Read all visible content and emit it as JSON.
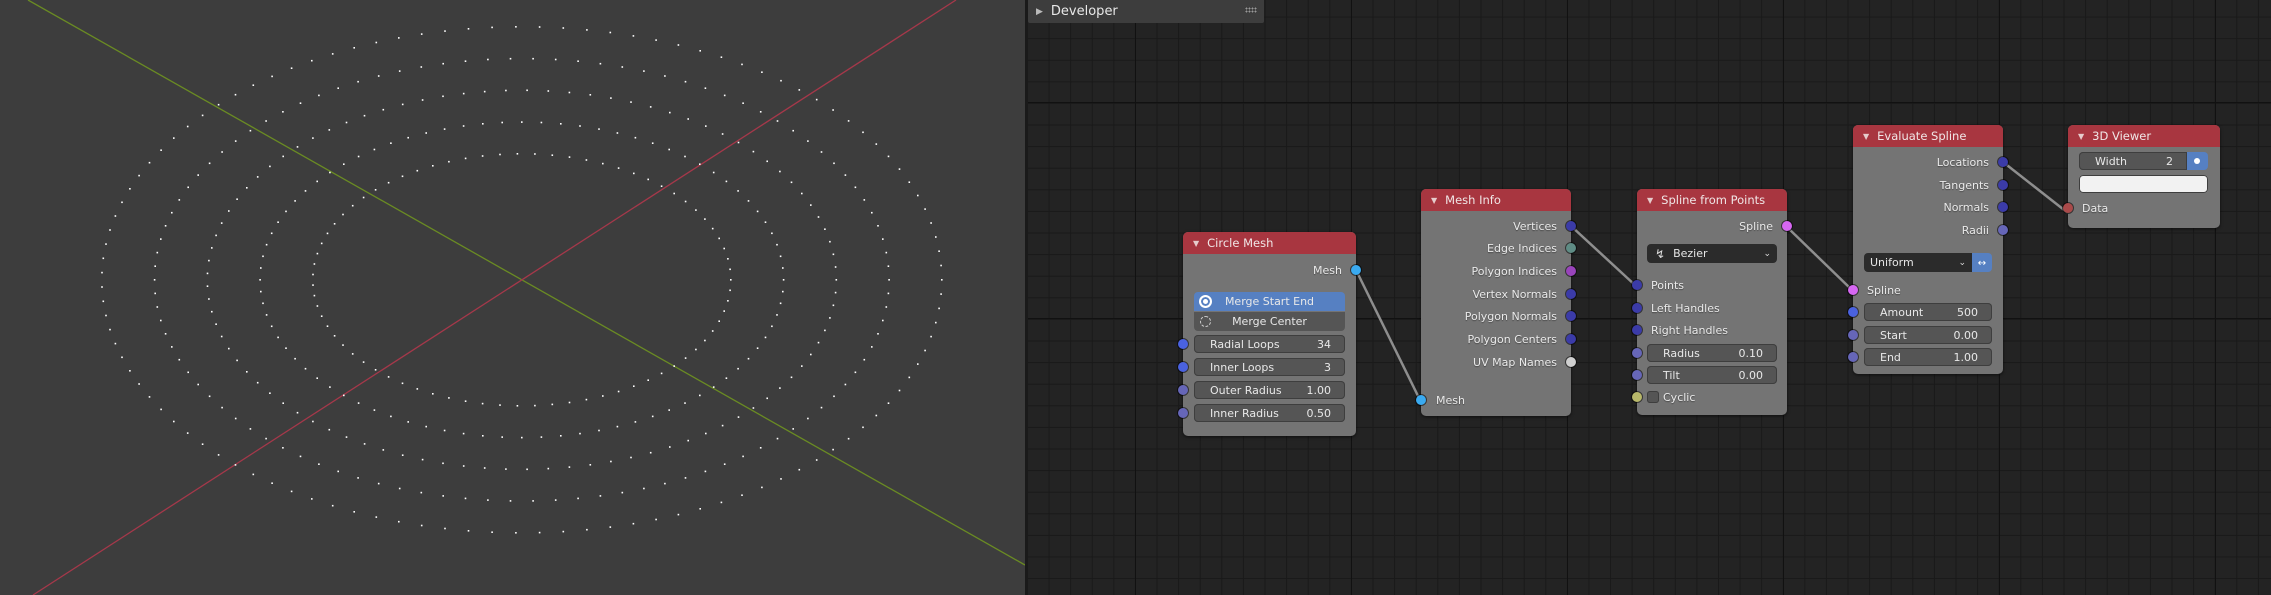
{
  "viewport": {
    "mesh_rings": 5,
    "points_per_ring": 34,
    "axis_x_color": "#a5384a",
    "axis_y_color": "#6a8b23",
    "point_color": "#ffffff",
    "background": "#3d3d3d"
  },
  "developer_panel": {
    "label": "Developer"
  },
  "colors": {
    "header": "#a83640",
    "node_body": "#747474",
    "socket_mesh": "#3aaaf0",
    "socket_vector": "#3b3ba8",
    "socket_float": "#6666b8",
    "socket_int": "#4a62e0",
    "socket_edge": "#5f8c85",
    "socket_poly": "#9944bb",
    "socket_string": "#cfcfcf",
    "socket_spline": "#d767f3",
    "socket_bool": "#b8b86a",
    "socket_generic": "#a94a4a",
    "wire": "#8e8e8e",
    "active_button": "#5680c2"
  },
  "nodes": {
    "circle_mesh": {
      "title": "Circle Mesh",
      "output": "Mesh",
      "toggle_active": "Merge Start End",
      "toggle_inactive": "Merge Center",
      "fields": [
        {
          "label": "Radial Loops",
          "value": "34"
        },
        {
          "label": "Inner Loops",
          "value": "3"
        },
        {
          "label": "Outer Radius",
          "value": "1.00"
        },
        {
          "label": "Inner Radius",
          "value": "0.50"
        }
      ]
    },
    "mesh_info": {
      "title": "Mesh Info",
      "outputs": [
        "Vertices",
        "Edge Indices",
        "Polygon Indices",
        "Vertex Normals",
        "Polygon Normals",
        "Polygon Centers",
        "UV Map Names"
      ],
      "input": "Mesh"
    },
    "spline_from_points": {
      "title": "Spline from Points",
      "output": "Spline",
      "type_option": "Bezier",
      "inputs": [
        "Points",
        "Left Handles",
        "Right Handles"
      ],
      "fields": [
        {
          "label": "Radius",
          "value": "0.10"
        },
        {
          "label": "Tilt",
          "value": "0.00"
        }
      ],
      "checkbox_label": "Cyclic",
      "checkbox_checked": false
    },
    "evaluate_spline": {
      "title": "Evaluate Spline",
      "outputs": [
        "Locations",
        "Tangents",
        "Normals",
        "Radii"
      ],
      "mode_option": "Uniform",
      "input": "Spline",
      "fields": [
        {
          "label": "Amount",
          "value": "500"
        },
        {
          "label": "Start",
          "value": "0.00"
        },
        {
          "label": "End",
          "value": "1.00"
        }
      ]
    },
    "viewer_3d": {
      "title": "3D Viewer",
      "width_label": "Width",
      "width_value": "2",
      "color_value": "#f2f2f2",
      "input": "Data"
    }
  }
}
